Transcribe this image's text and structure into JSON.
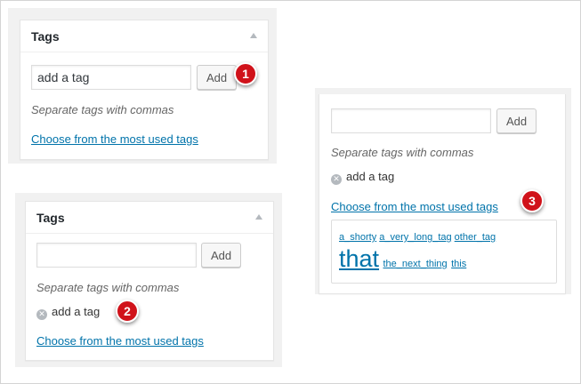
{
  "panel1": {
    "title": "Tags",
    "input_value": "add a tag",
    "add_label": "Add",
    "hint": "Separate tags with commas",
    "link": "Choose from the most used tags",
    "badge": "1"
  },
  "panel2": {
    "title": "Tags",
    "input_value": "",
    "add_label": "Add",
    "hint": "Separate tags with commas",
    "tag": "add a tag",
    "link": "Choose from the most used tags",
    "badge": "2"
  },
  "panel3": {
    "input_value": "",
    "add_label": "Add",
    "hint": "Separate tags with commas",
    "tag": "add a tag",
    "link": "Choose from the most used tags",
    "badge": "3",
    "cloud": {
      "t1": "a_shorty",
      "t2": "a_very_long_tag",
      "t3": "other_tag",
      "t4": "that",
      "t5": "the_next_thing",
      "t6": "this"
    }
  },
  "colors": {
    "link": "#0073aa",
    "badge": "#d0121a",
    "background": "#f1f1f1"
  }
}
